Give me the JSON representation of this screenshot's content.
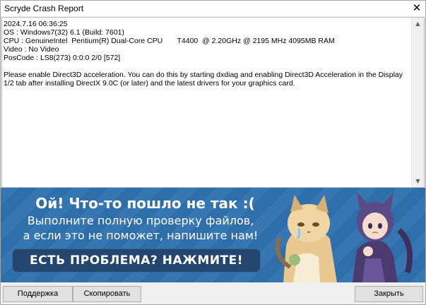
{
  "window": {
    "title": "Scryde Crash Report",
    "close_glyph": "✕"
  },
  "report": {
    "text": "2024.7.16 06:36:25\nOS : Windows7(32) 6.1 (Build: 7601)\nCPU : GenuineIntel  Pentium(R) Dual-Core CPU       T4400  @ 2.20GHz @ 2195 MHz 4095MB RAM\nVideo : No Video\nPosCode : LS8(273) 0:0:0 2/0 [572]\n\nPlease enable Direct3D acceleration. You can do this by starting dxdiag and enabling Direct3D Acceleration in the Display 1/2 tab after installing DirectX 9.0C (or later) and the latest drivers for your graphics card.",
    "scroll_up_glyph": "▲",
    "scroll_down_glyph": "▼"
  },
  "banner": {
    "headline": "Ой! Что-то пошло не так :(",
    "line1": "Выполните полную проверку файлов,",
    "line2": "а если это не поможет, напишите нам!",
    "cta_label": "ЕСТЬ ПРОБЛЕМА? НАЖМИТЕ!",
    "background_color": "#2f72b0",
    "cta_color": "#22466e"
  },
  "buttons": {
    "support": "Поддержка",
    "copy": "Скопировать",
    "close": "Закрыть"
  }
}
